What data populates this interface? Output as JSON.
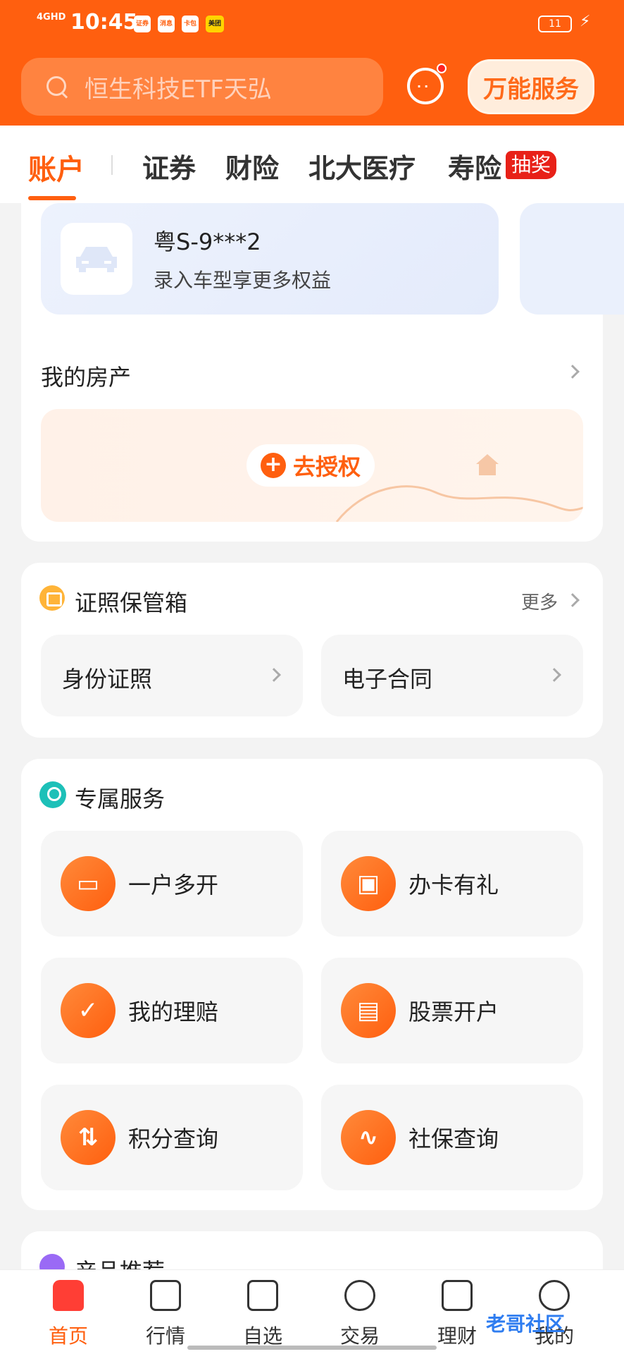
{
  "status_bar": {
    "network": "4GHD",
    "time": "10:45",
    "battery": "11",
    "app_icons": [
      "证券",
      "消息",
      "卡包",
      "美团"
    ]
  },
  "search": {
    "placeholder": "恒生科技ETF天弘"
  },
  "header": {
    "service_button": "万能服务"
  },
  "tabs": [
    {
      "label": "账户",
      "active": true
    },
    {
      "label": "证券"
    },
    {
      "label": "财险"
    },
    {
      "label": "北大医疗"
    },
    {
      "label": "寿险",
      "badge": "抽奖"
    }
  ],
  "vehicle": {
    "plate": "粤S-9***2",
    "subtitle": "录入车型享更多权益"
  },
  "property": {
    "title": "我的房产",
    "action": "去授权"
  },
  "certificates": {
    "title": "证照保管箱",
    "more": "更多",
    "items": [
      "身份证照",
      "电子合同"
    ]
  },
  "services": {
    "title": "专属服务",
    "items": [
      "一户多开",
      "办卡有礼",
      "我的理赔",
      "股票开户",
      "积分查询",
      "社保查询"
    ]
  },
  "products": {
    "title": "产品推荐"
  },
  "bottom_nav": [
    {
      "label": "首页",
      "active": true
    },
    {
      "label": "行情"
    },
    {
      "label": "自选"
    },
    {
      "label": "交易"
    },
    {
      "label": "理财"
    },
    {
      "label": "我的"
    }
  ],
  "watermark": "老哥社区",
  "colors": {
    "brand": "#ff5f0f",
    "badge": "#e82118",
    "teal": "#1dc0b8"
  }
}
